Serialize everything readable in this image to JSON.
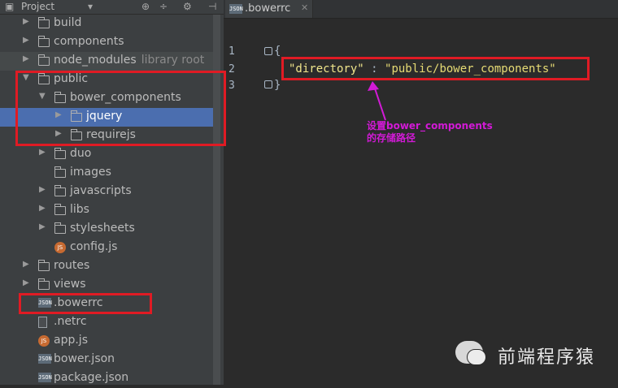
{
  "colors": {
    "accent_selection": "#4b6eaf",
    "annotation": "#d21ad6",
    "highlight_box": "#e01b24"
  },
  "project_panel": {
    "title": "Project",
    "tree": [
      {
        "label": "build",
        "icon": "folder-icon",
        "arrow": "collapsed"
      },
      {
        "label": "components",
        "icon": "folder-icon",
        "arrow": "collapsed"
      },
      {
        "label": "node_modules",
        "hint": "library root",
        "icon": "folder-icon",
        "arrow": "collapsed"
      },
      {
        "label": "public",
        "icon": "folder-icon",
        "arrow": "expanded"
      },
      {
        "label": "bower_components",
        "icon": "folder-icon",
        "arrow": "expanded"
      },
      {
        "label": "jquery",
        "icon": "folder-icon",
        "arrow": "collapsed",
        "selected": true
      },
      {
        "label": "requirejs",
        "icon": "folder-icon",
        "arrow": "collapsed"
      },
      {
        "label": "duo",
        "icon": "folder-icon",
        "arrow": "collapsed"
      },
      {
        "label": "images",
        "icon": "folder-icon"
      },
      {
        "label": "javascripts",
        "icon": "folder-icon",
        "arrow": "collapsed"
      },
      {
        "label": "libs",
        "icon": "folder-icon",
        "arrow": "collapsed"
      },
      {
        "label": "stylesheets",
        "icon": "folder-icon",
        "arrow": "collapsed"
      },
      {
        "label": "config.js",
        "icon": "js-file-icon"
      },
      {
        "label": "routes",
        "icon": "folder-icon",
        "arrow": "collapsed"
      },
      {
        "label": "views",
        "icon": "folder-icon",
        "arrow": "collapsed"
      },
      {
        "label": ".bowerrc",
        "icon": "json-file-icon"
      },
      {
        "label": ".netrc",
        "icon": "text-file-icon"
      },
      {
        "label": "app.js",
        "icon": "js-file-icon"
      },
      {
        "label": "bower.json",
        "icon": "json-file-icon"
      },
      {
        "label": "package.json",
        "icon": "json-file-icon"
      }
    ]
  },
  "editor": {
    "tab_label": ".bowerrc",
    "lines": [
      "1",
      "2",
      "3"
    ],
    "open_brace": "{",
    "key": "\"directory\"",
    "colon": " : ",
    "value": "\"public/bower_components\"",
    "close_brace": "}"
  },
  "annotation": {
    "line1": "设置bower_components",
    "line2": "的存储路径"
  },
  "watermark": {
    "text": "前端程序猿"
  }
}
